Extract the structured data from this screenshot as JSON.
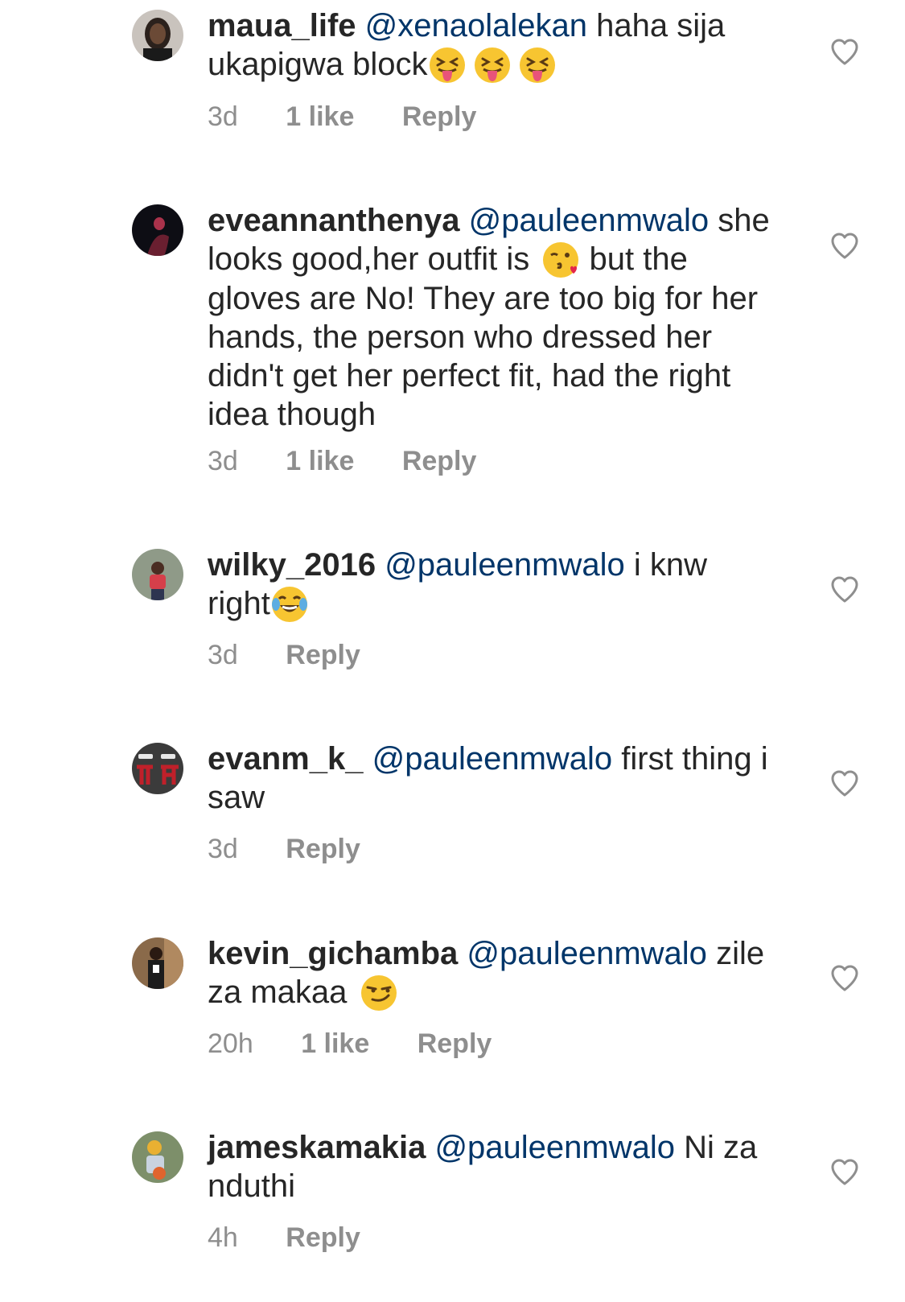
{
  "comments": [
    {
      "username": "maua_life",
      "mention": "@xenaolalekan",
      "text_before_emoji": "haha sija ukapigwa block",
      "emojis": [
        "squinting-face-with-tongue",
        "squinting-face-with-tongue",
        "squinting-face-with-tongue"
      ],
      "time": "3d",
      "likes": "1 like",
      "reply": "Reply"
    },
    {
      "username": "eveannanthenya",
      "mention": "@pauleenmwalo",
      "text_before_emoji": "she looks good,her outfit is",
      "emojis": [
        "face-blowing-kiss"
      ],
      "text_after_emoji": "but the gloves are No! They are too big for her hands, the person who dressed her didn't get her perfect fit, had the right idea though",
      "time": "3d",
      "likes": "1 like",
      "reply": "Reply"
    },
    {
      "username": "wilky_2016",
      "mention": "@pauleenmwalo",
      "text_before_emoji": "i knw right",
      "emojis": [
        "face-with-tears-of-joy"
      ],
      "time": "3d",
      "reply": "Reply"
    },
    {
      "username": "evanm_k_",
      "mention": "@pauleenmwalo",
      "text_before_emoji": "first thing i saw",
      "time": "3d",
      "reply": "Reply"
    },
    {
      "username": "kevin_gichamba",
      "mention": "@pauleenmwalo",
      "text_before_emoji": "zile za makaa",
      "emojis": [
        "smirking-face"
      ],
      "time": "20h",
      "likes": "1 like",
      "reply": "Reply"
    },
    {
      "username": "jameskamakia",
      "mention": "@pauleenmwalo",
      "text_before_emoji": "Ni za nduthi",
      "time": "4h",
      "reply": "Reply"
    }
  ],
  "colors": {
    "text": "#262626",
    "mention": "#003569",
    "meta": "#8e8e8e",
    "heart": "#8e8e8e"
  },
  "icons": {
    "like": "heart-outline-icon"
  }
}
